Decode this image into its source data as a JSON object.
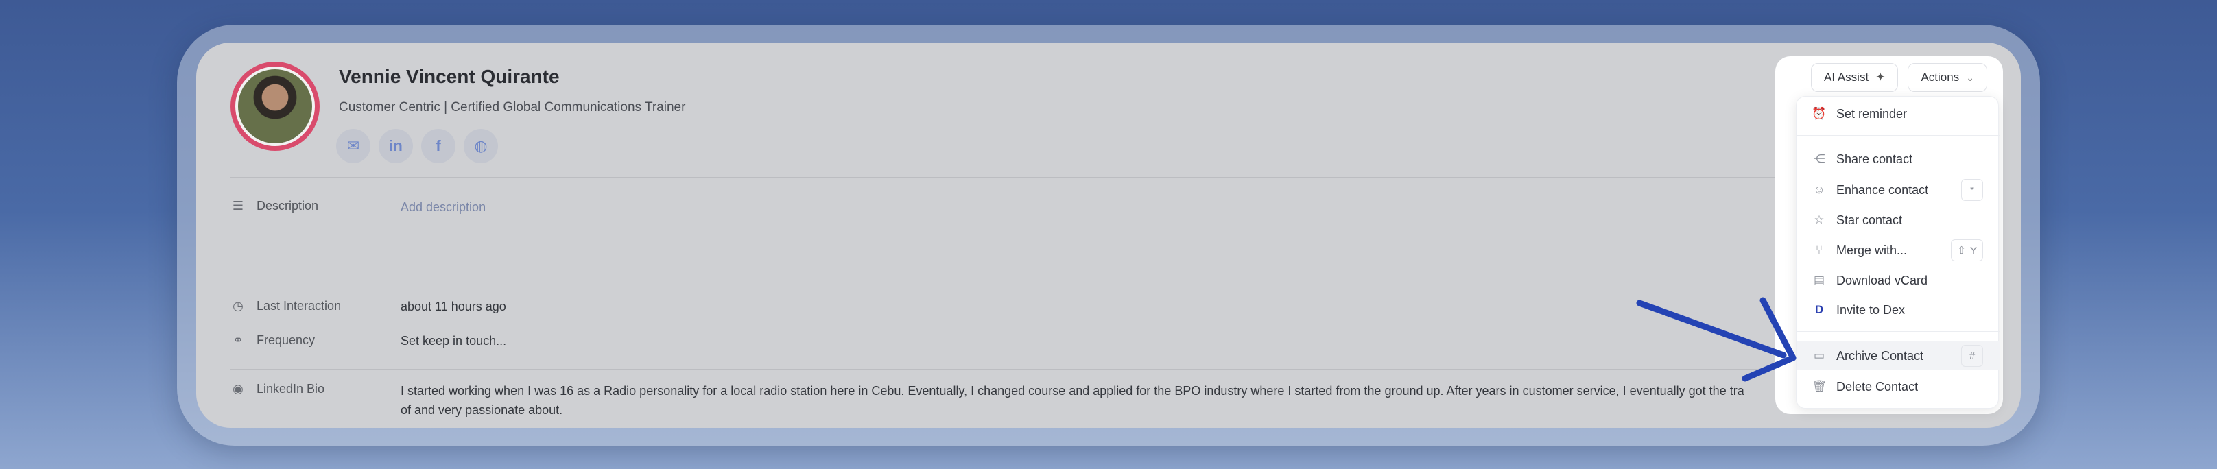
{
  "contact": {
    "name": "Vennie Vincent Quirante",
    "subtitle": "Customer Centric | Certified Global Communications Trainer"
  },
  "socials": [
    {
      "icon": "email-icon",
      "glyph": "✉"
    },
    {
      "icon": "linkedin-icon",
      "glyph": "in"
    },
    {
      "icon": "facebook-icon",
      "glyph": "f"
    },
    {
      "icon": "messenger-icon",
      "glyph": "◍"
    }
  ],
  "fields": {
    "description_label": "Description",
    "description_placeholder": "Add description",
    "last_interaction_label": "Last Interaction",
    "last_interaction_value": "about 11 hours ago",
    "frequency_label": "Frequency",
    "frequency_value": "Set keep in touch...",
    "linkedin_bio_label": "LinkedIn Bio",
    "linkedin_bio_value": "I started working when I was 16 as a Radio personality for a local radio station here in Cebu. Eventually, I changed course and applied for the BPO industry where I started from the ground up. After years in customer service, I eventually got the tra",
    "linkedin_bio_value_line2": "of and very passionate about."
  },
  "toolbar": {
    "ai_assist_label": "AI Assist",
    "actions_label": "Actions"
  },
  "menu": {
    "set_reminder": "Set reminder",
    "share_contact": "Share contact",
    "enhance_contact": "Enhance contact",
    "enhance_shortcut": "*",
    "star_contact": "Star contact",
    "merge_with": "Merge with...",
    "merge_shortcut_key": "Y",
    "download_vcard": "Download vCard",
    "invite_to_dex": "Invite to Dex",
    "archive_contact": "Archive Contact",
    "archive_shortcut": "#",
    "delete_contact": "Delete Contact"
  },
  "colors": {
    "accent_arrow": "#2443b4",
    "avatar_ring": "#d94b6c"
  }
}
